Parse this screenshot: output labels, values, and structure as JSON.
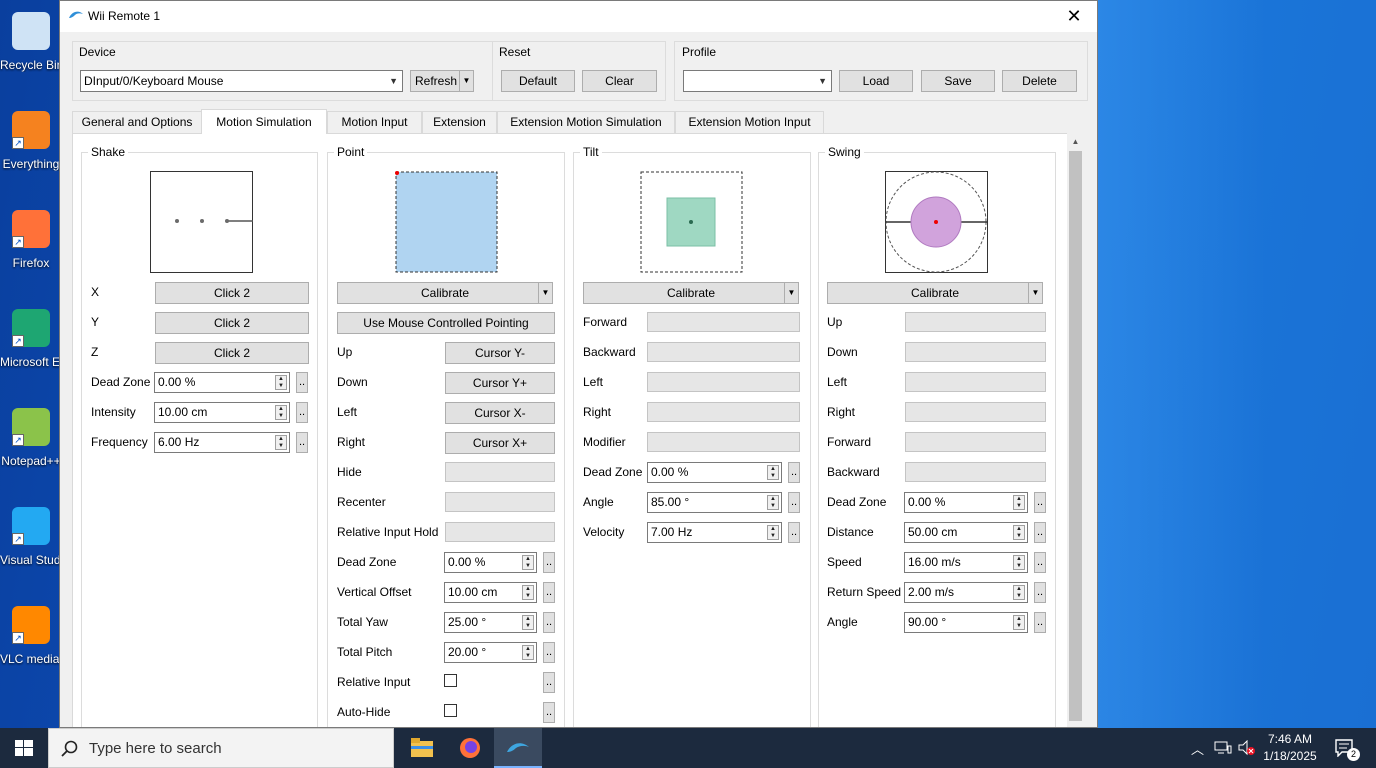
{
  "desktop": {
    "icons": [
      {
        "label": "Recycle Bin",
        "icon": "recycle-bin-icon",
        "color": "#cfe3f5"
      },
      {
        "label": "Everything",
        "icon": "everything-search-icon",
        "color": "#f5821f"
      },
      {
        "label": "Firefox",
        "icon": "firefox-icon",
        "color": "#ff7139"
      },
      {
        "label": "Microsoft Edge",
        "icon": "edge-icon",
        "color": "#1ea672"
      },
      {
        "label": "Notepad++",
        "icon": "notepad-plus-plus-icon",
        "color": "#8bc34a"
      },
      {
        "label": "Visual Studio Code",
        "icon": "vscode-icon",
        "color": "#23a9f2"
      },
      {
        "label": "VLC media player",
        "icon": "vlc-icon",
        "color": "#ff8800"
      }
    ]
  },
  "window": {
    "title": "Wii Remote 1",
    "close_glyph": "✕",
    "device": {
      "group_label": "Device",
      "selected": "DInput/0/Keyboard Mouse",
      "refresh_label": "Refresh"
    },
    "reset": {
      "group_label": "Reset",
      "default_label": "Default",
      "clear_label": "Clear"
    },
    "profile": {
      "group_label": "Profile",
      "selected": "",
      "load_label": "Load",
      "save_label": "Save",
      "delete_label": "Delete"
    },
    "tabs": [
      {
        "label": "General and Options",
        "active": false
      },
      {
        "label": "Motion Simulation",
        "active": true
      },
      {
        "label": "Motion Input",
        "active": false
      },
      {
        "label": "Extension",
        "active": false
      },
      {
        "label": "Extension Motion Simulation",
        "active": false
      },
      {
        "label": "Extension Motion Input",
        "active": false
      }
    ],
    "shake": {
      "title": "Shake",
      "rows": [
        {
          "label": "X",
          "value": "Click 2"
        },
        {
          "label": "Y",
          "value": "Click 2"
        },
        {
          "label": "Z",
          "value": "Click 2"
        }
      ],
      "settings": [
        {
          "label": "Dead Zone",
          "value": "0.00 %"
        },
        {
          "label": "Intensity",
          "value": "10.00 cm"
        },
        {
          "label": "Frequency",
          "value": "6.00 Hz"
        }
      ]
    },
    "point": {
      "title": "Point",
      "calibrate_label": "Calibrate",
      "mouse_pointing_label": "Use Mouse Controlled Pointing",
      "rows": [
        {
          "label": "Up",
          "value": "Cursor Y-"
        },
        {
          "label": "Down",
          "value": "Cursor Y+"
        },
        {
          "label": "Left",
          "value": "Cursor X-"
        },
        {
          "label": "Right",
          "value": "Cursor X+"
        },
        {
          "label": "Hide",
          "value": ""
        },
        {
          "label": "Recenter",
          "value": ""
        },
        {
          "label": "Relative Input Hold",
          "value": ""
        }
      ],
      "settings": [
        {
          "label": "Dead Zone",
          "value": "0.00 %"
        },
        {
          "label": "Vertical Offset",
          "value": "10.00 cm"
        },
        {
          "label": "Total Yaw",
          "value": "25.00 °"
        },
        {
          "label": "Total Pitch",
          "value": "20.00 °"
        }
      ],
      "checks": [
        {
          "label": "Relative Input",
          "checked": false
        },
        {
          "label": "Auto-Hide",
          "checked": false
        }
      ],
      "preview_color": "#b0d4f1"
    },
    "tilt": {
      "title": "Tilt",
      "calibrate_label": "Calibrate",
      "rows": [
        {
          "label": "Forward",
          "value": ""
        },
        {
          "label": "Backward",
          "value": ""
        },
        {
          "label": "Left",
          "value": ""
        },
        {
          "label": "Right",
          "value": ""
        },
        {
          "label": "Modifier",
          "value": ""
        }
      ],
      "settings": [
        {
          "label": "Dead Zone",
          "value": "0.00 %"
        },
        {
          "label": "Angle",
          "value": "85.00 °"
        },
        {
          "label": "Velocity",
          "value": "7.00 Hz"
        }
      ],
      "preview_color": "#9fd8c2"
    },
    "swing": {
      "title": "Swing",
      "calibrate_label": "Calibrate",
      "rows": [
        {
          "label": "Up",
          "value": ""
        },
        {
          "label": "Down",
          "value": ""
        },
        {
          "label": "Left",
          "value": ""
        },
        {
          "label": "Right",
          "value": ""
        },
        {
          "label": "Forward",
          "value": ""
        },
        {
          "label": "Backward",
          "value": ""
        }
      ],
      "settings": [
        {
          "label": "Dead Zone",
          "value": "0.00 %"
        },
        {
          "label": "Distance",
          "value": "50.00 cm"
        },
        {
          "label": "Speed",
          "value": "16.00 m/s"
        },
        {
          "label": "Return Speed",
          "value": "2.00 m/s"
        },
        {
          "label": "Angle",
          "value": "90.00 °"
        }
      ],
      "preview_color": "#d1a3dc"
    }
  },
  "taskbar": {
    "search_placeholder": "Type here to search",
    "apps": [
      {
        "name": "file-explorer-icon",
        "color": "#f2c14e"
      },
      {
        "name": "firefox-icon",
        "color": "#ff7139"
      },
      {
        "name": "dolphin-icon",
        "color": "#3ea6e0"
      }
    ],
    "time": "7:46 AM",
    "date": "1/18/2025",
    "notification_count": "2"
  }
}
